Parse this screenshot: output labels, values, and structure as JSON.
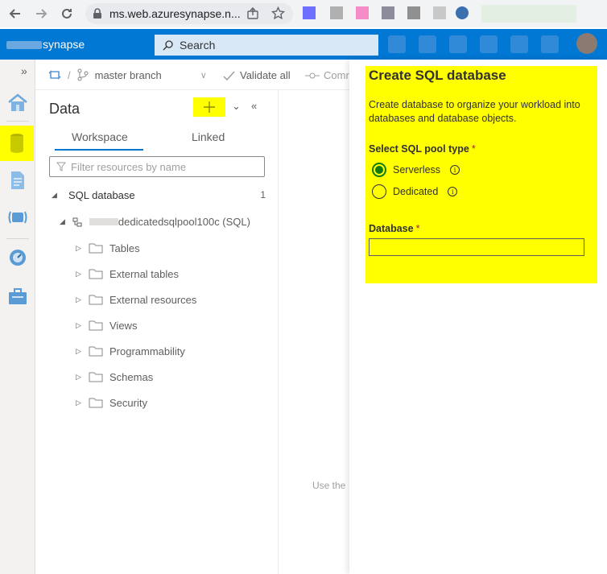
{
  "browser": {
    "url": "ms.web.azuresynapse.n..."
  },
  "header": {
    "brand": "synapse",
    "search_label": "Search"
  },
  "toolbar": {
    "branch": "master branch",
    "validate_all": "Validate all",
    "commit": "Comr"
  },
  "data_panel": {
    "title": "Data",
    "add_icon": "plus-icon",
    "tabs": [
      {
        "label": "Workspace",
        "active": true
      },
      {
        "label": "Linked",
        "active": false
      }
    ],
    "filter_placeholder": "Filter resources by name",
    "section": {
      "label": "SQL database",
      "count": "1"
    },
    "pool": {
      "name": "dedicatedsqlpool100c (SQL)"
    },
    "items": [
      {
        "label": "Tables"
      },
      {
        "label": "External tables"
      },
      {
        "label": "External resources"
      },
      {
        "label": "Views"
      },
      {
        "label": "Programmability"
      },
      {
        "label": "Schemas"
      },
      {
        "label": "Security"
      }
    ]
  },
  "center": {
    "hint": "Use the"
  },
  "flyout": {
    "title": "Create SQL database",
    "description": "Create database to organize your workload into databases and database objects.",
    "pool_type_label": "Select SQL pool type",
    "required_mark": "*",
    "options": [
      {
        "label": "Serverless",
        "selected": true
      },
      {
        "label": "Dedicated",
        "selected": false
      }
    ],
    "info_glyph": "i",
    "database_label": "Database",
    "database_value": ""
  },
  "colors": {
    "azure_blue": "#0078d4",
    "highlight": "#ffff00",
    "selected_radio": "#107c10"
  }
}
